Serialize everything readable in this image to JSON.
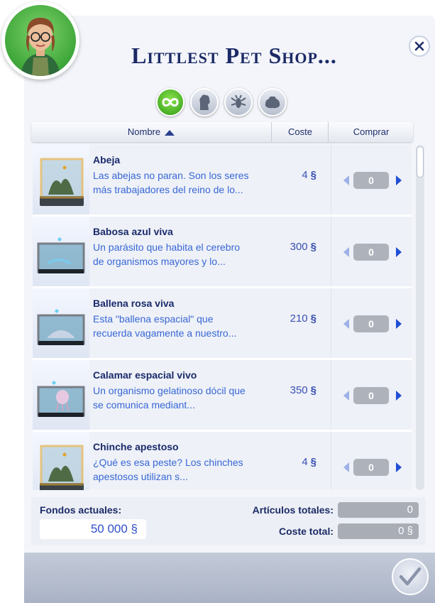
{
  "window": {
    "title": "Littlest Pet Shop...",
    "colors": {
      "title": "#1b2a66",
      "accent": "#3867d6",
      "filter_active": "#2f9b16"
    }
  },
  "filters": [
    {
      "name": "all-filter-icon",
      "active": true
    },
    {
      "name": "category-filter-icon-1",
      "active": false
    },
    {
      "name": "category-filter-icon-2",
      "active": false
    },
    {
      "name": "category-filter-icon-3",
      "active": false
    }
  ],
  "columns": {
    "name": "Nombre",
    "cost": "Coste",
    "buy": "Comprar"
  },
  "items": [
    {
      "name": "Abeja",
      "desc1": "Las abejas no paran. Son los seres",
      "desc2": "más trabajadores del reino de lo...",
      "price": "4",
      "currency": "§",
      "qty": "0",
      "habitat": "gold"
    },
    {
      "name": "Babosa azul viva",
      "desc1": "Un parásito que habita el cerebro",
      "desc2": "de organismos mayores y lo...",
      "price": "300",
      "currency": "§",
      "qty": "0",
      "habitat": "tank"
    },
    {
      "name": "Ballena rosa viva",
      "desc1": "Esta \"ballena espacial\" que",
      "desc2": "recuerda vagamente a nuestro...",
      "price": "210",
      "currency": "§",
      "qty": "0",
      "habitat": "tank"
    },
    {
      "name": "Calamar espacial vivo",
      "desc1": "Un organismo gelatinoso dócil que",
      "desc2": "se comunica mediant...",
      "price": "350",
      "currency": "§",
      "qty": "0",
      "habitat": "tank"
    },
    {
      "name": "Chinche apestoso",
      "desc1": "¿Qué es esa peste? Los chinches",
      "desc2": "apestosos utilizan s...",
      "price": "4",
      "currency": "§",
      "qty": "0",
      "habitat": "gold"
    }
  ],
  "footer": {
    "funds_label": "Fondos actuales:",
    "funds_value": "50 000 §",
    "total_items_label": "Artículos totales:",
    "total_items_value": "0",
    "total_cost_label": "Coste total:",
    "total_cost_value": "0 §"
  }
}
